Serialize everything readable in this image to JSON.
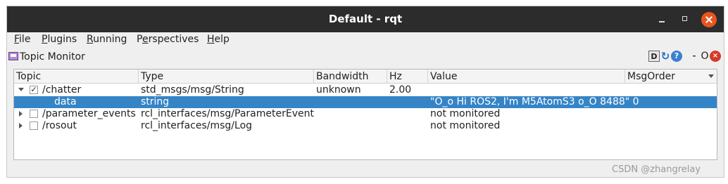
{
  "window": {
    "title": "Default - rqt"
  },
  "menubar": {
    "items": [
      {
        "acc": "F",
        "rest": "ile"
      },
      {
        "acc": "P",
        "rest": "lugins"
      },
      {
        "acc": "R",
        "rest": "unning"
      },
      {
        "pre": "P",
        "acc": "e",
        "rest": "rspectives"
      },
      {
        "acc": "H",
        "rest": "elp"
      }
    ]
  },
  "plugin": {
    "title": "Topic Monitor",
    "controls": {
      "d": "D",
      "dash": "-",
      "o": "O",
      "x": "×"
    }
  },
  "table": {
    "columns": [
      "Topic",
      "Type",
      "Bandwidth",
      "Hz",
      "Value",
      "MsgOrder"
    ],
    "rows": [
      {
        "topic": "/chatter",
        "type": "std_msgs/msg/String",
        "bandwidth": "unknown",
        "hz": "2.00",
        "value": "",
        "msgorder": "",
        "checked": true,
        "expanded": true
      },
      {
        "topic": "data",
        "type": "string",
        "bandwidth": "",
        "hz": "",
        "value": "\"O_o Hi ROS2, I'm M5AtomS3 o_O 8488\"  0",
        "msgorder": "",
        "selected": true
      },
      {
        "topic": "/parameter_events",
        "type": "rcl_interfaces/msg/ParameterEvent",
        "bandwidth": "",
        "hz": "",
        "value": "not monitored",
        "msgorder": "",
        "checked": false
      },
      {
        "topic": "/rosout",
        "type": "rcl_interfaces/msg/Log",
        "bandwidth": "",
        "hz": "",
        "value": "not monitored",
        "msgorder": "",
        "checked": false
      }
    ],
    "checkmark": "✓"
  },
  "watermark": "CSDN @zhangrelay",
  "colors": {
    "titlebar": "#2c2c2c",
    "close": "#e95420",
    "selection": "#3584c6"
  }
}
